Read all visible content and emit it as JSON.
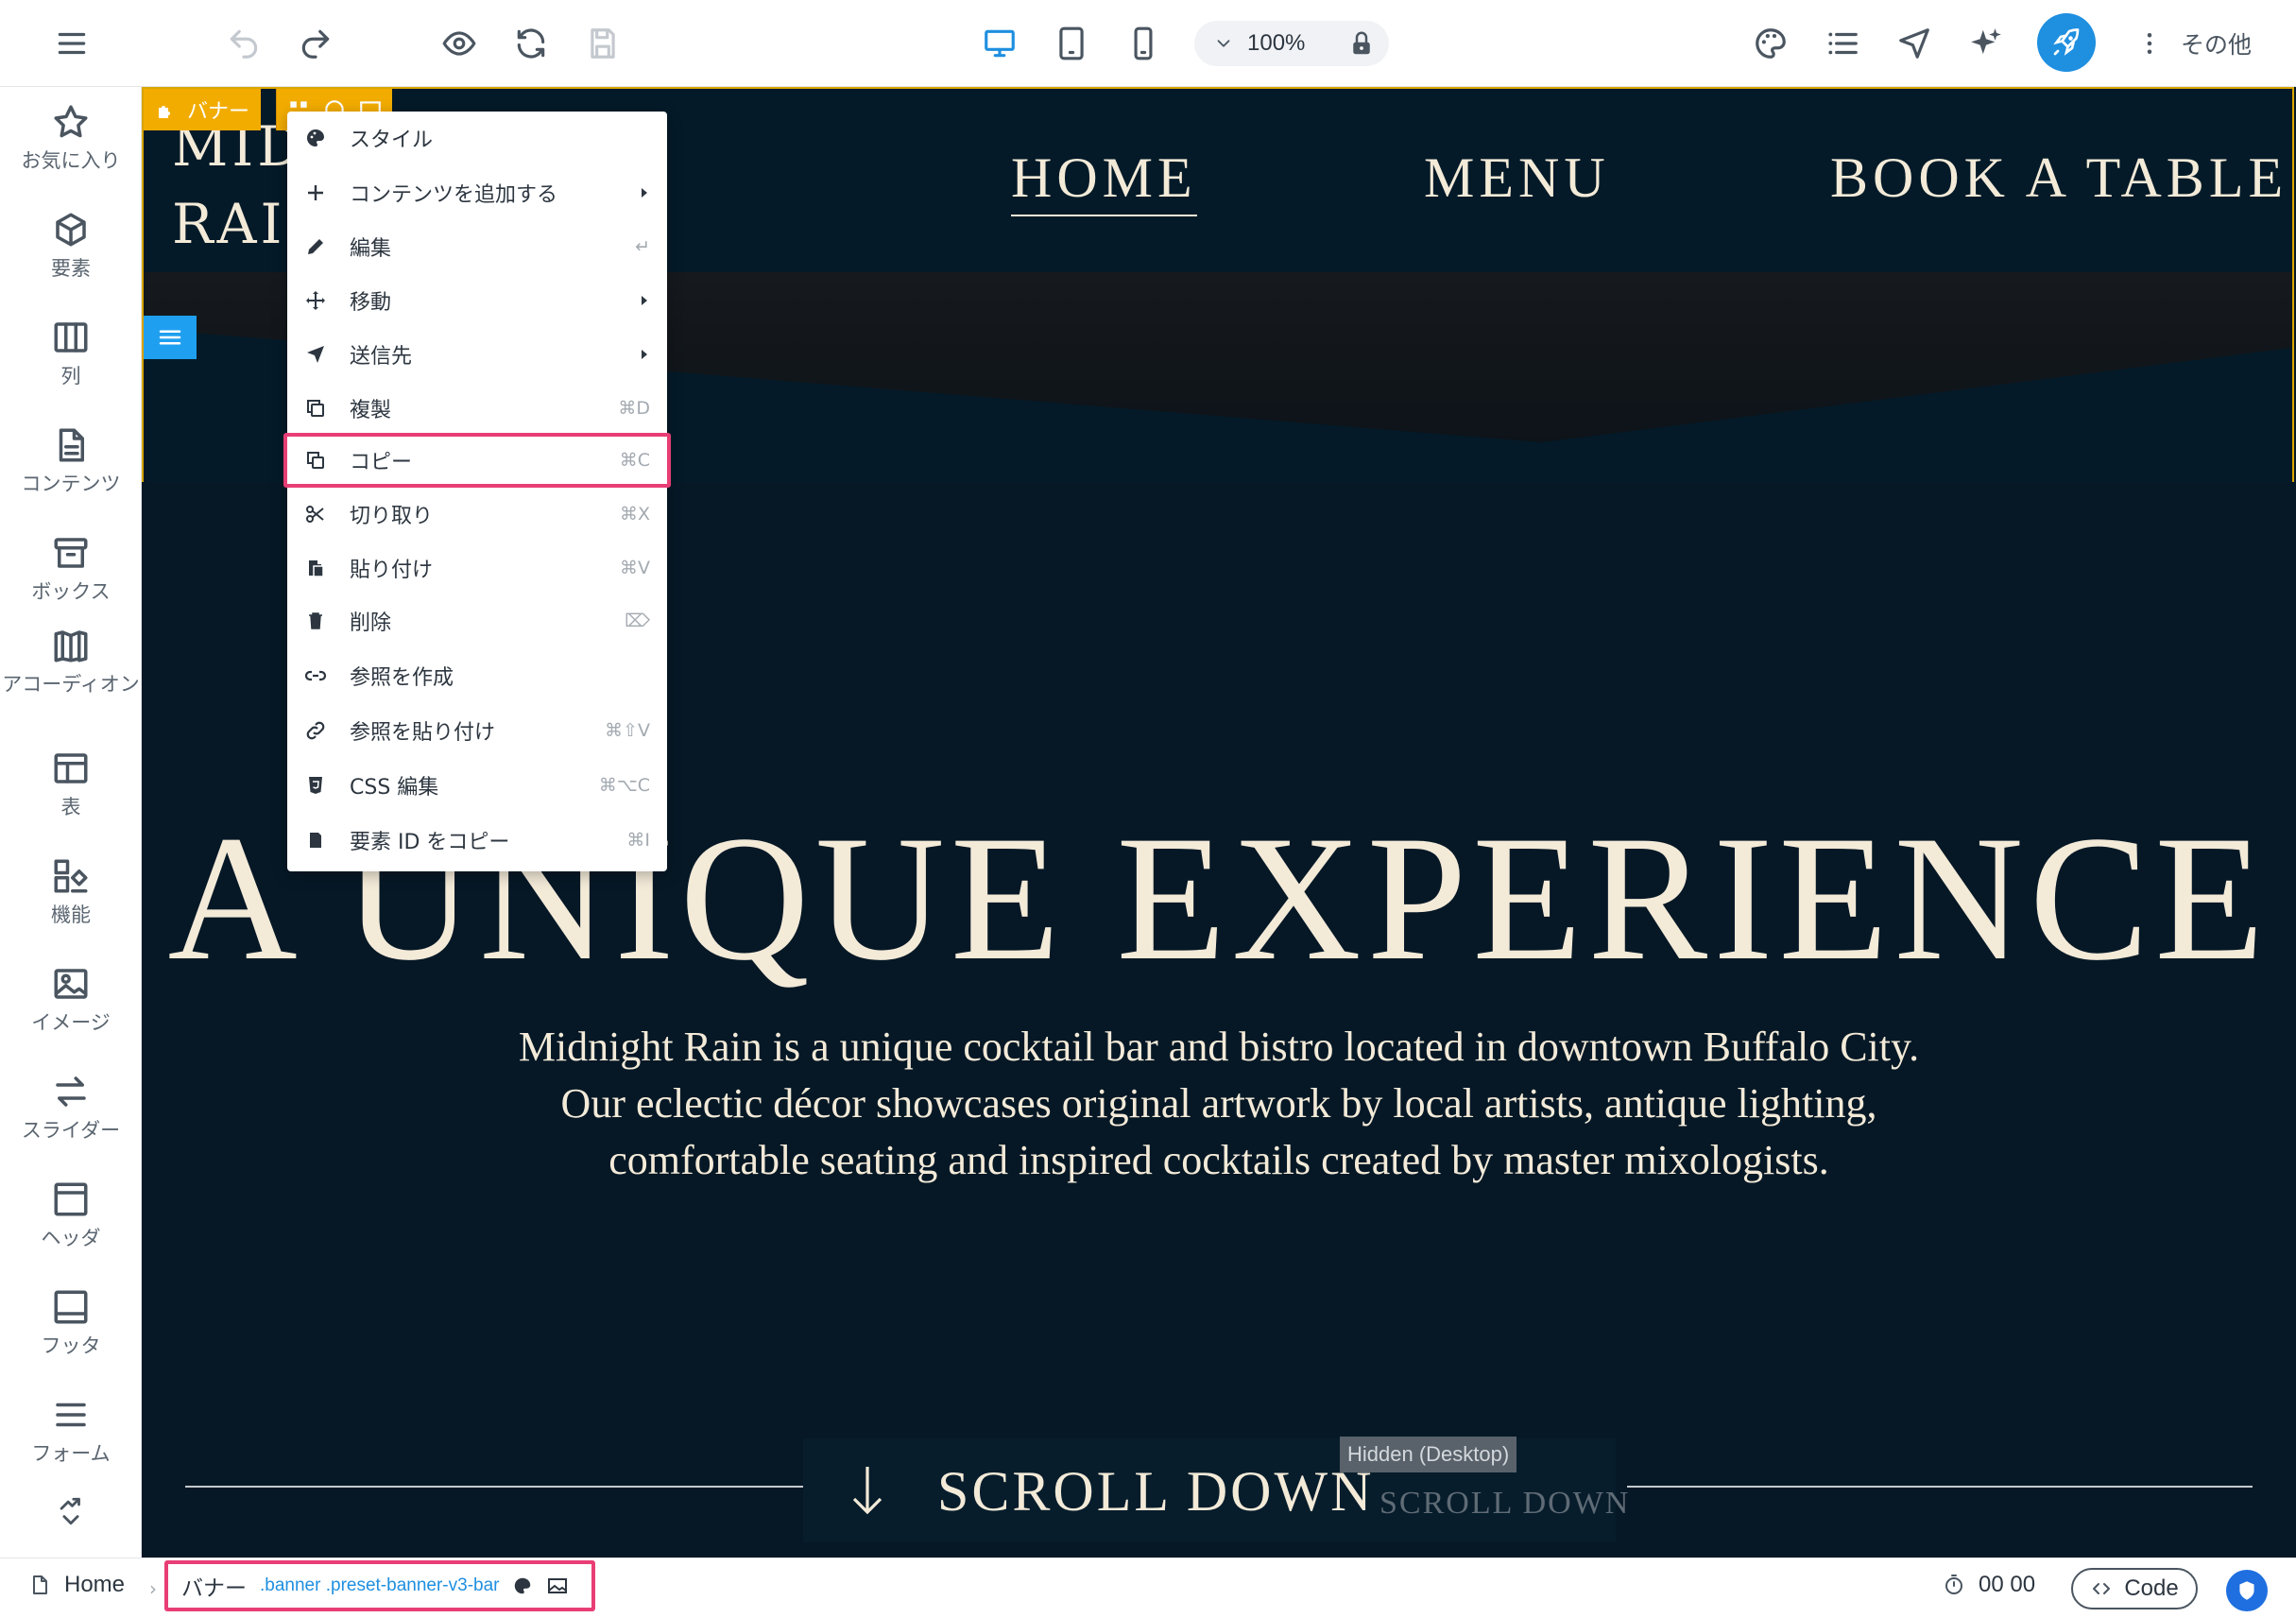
{
  "toolbar": {
    "zoom": "100%",
    "more_label": "その他",
    "active_device": "desktop"
  },
  "sidebar": {
    "items": [
      {
        "label": "お気に入り",
        "icon": "star-icon"
      },
      {
        "label": "要素",
        "icon": "cube-icon"
      },
      {
        "label": "列",
        "icon": "columns-icon"
      },
      {
        "label": "コンテンツ",
        "icon": "document-icon"
      },
      {
        "label": "ボックス",
        "icon": "box-icon"
      },
      {
        "label": "アコーディオン",
        "icon": "accordion-icon"
      },
      {
        "label": "表",
        "icon": "table-icon"
      },
      {
        "label": "機能",
        "icon": "features-icon"
      },
      {
        "label": "イメージ",
        "icon": "image-icon"
      },
      {
        "label": "スライダー",
        "icon": "slider-icon"
      },
      {
        "label": "ヘッダ",
        "icon": "header-icon"
      },
      {
        "label": "フッタ",
        "icon": "footer-icon"
      },
      {
        "label": "フォーム",
        "icon": "form-icon"
      }
    ]
  },
  "canvas": {
    "banner_label": "バナー",
    "logo_text": "MIDNIGHT\nRAIN",
    "nav": {
      "home": "HOME",
      "menu": "MENU",
      "book": "BOOK A TABLE"
    },
    "hero_title": "A UNIQUE EXPERIENCE",
    "hero_desc_lines": [
      "Midnight Rain is a unique cocktail bar and bistro located in downtown Buffalo City.",
      "Our eclectic décor showcases original artwork by local artists, antique lighting,",
      "comfortable seating and inspired cocktails created by master mixologists."
    ],
    "scroll_text": "SCROLL DOWN",
    "scroll_ghost_text": "SCROLL DOWN",
    "hidden_tooltip": "Hidden (Desktop)"
  },
  "context_menu": {
    "items": [
      {
        "label": "スタイル",
        "shortcut": "",
        "icon": "palette-icon",
        "submenu": false
      },
      {
        "label": "コンテンツを追加する",
        "shortcut": "",
        "icon": "plus-icon",
        "submenu": true
      },
      {
        "label": "編集",
        "shortcut": "↵",
        "icon": "pencil-icon",
        "submenu": false
      },
      {
        "label": "移動",
        "shortcut": "",
        "icon": "move-icon",
        "submenu": true
      },
      {
        "label": "送信先",
        "shortcut": "",
        "icon": "send-icon",
        "submenu": true
      },
      {
        "label": "複製",
        "shortcut": "⌘D",
        "icon": "duplicate-icon",
        "submenu": false
      },
      {
        "label": "コピー",
        "shortcut": "⌘C",
        "icon": "copy-icon",
        "submenu": false
      },
      {
        "label": "切り取り",
        "shortcut": "⌘X",
        "icon": "scissors-icon",
        "submenu": false
      },
      {
        "label": "貼り付け",
        "shortcut": "⌘V",
        "icon": "paste-icon",
        "submenu": false
      },
      {
        "label": "削除",
        "shortcut": "⌦",
        "icon": "trash-icon",
        "submenu": false
      },
      {
        "label": "参照を作成",
        "shortcut": "",
        "icon": "link-icon",
        "submenu": false
      },
      {
        "label": "参照を貼り付け",
        "shortcut": "⌘⇧V",
        "icon": "link-paste-icon",
        "submenu": false
      },
      {
        "label": "CSS 編集",
        "shortcut": "⌘⌥C",
        "icon": "css-icon",
        "submenu": false
      },
      {
        "label": "要素 ID をコピー",
        "shortcut": "⌘I",
        "icon": "id-copy-icon",
        "submenu": false
      }
    ],
    "highlighted": "コピー"
  },
  "statusbar": {
    "page": "Home",
    "crumb_name": "バナー",
    "crumb_classes": ".banner .preset-banner-v3-bar",
    "timer": "00 00",
    "code_label": "Code"
  },
  "colors": {
    "accent": "#1f8fe0",
    "selection_outline": "#d9a400",
    "annotation": "#e83e76",
    "canvas_bg": "#061826",
    "cream_text": "#f3ead8"
  }
}
